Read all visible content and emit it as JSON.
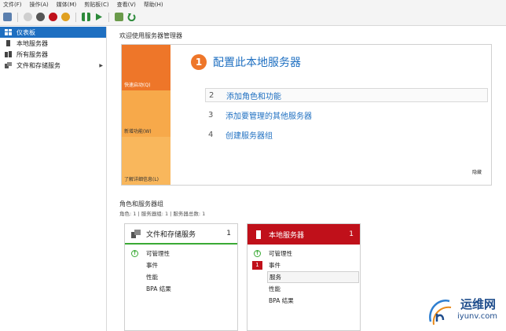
{
  "menu": [
    "文件(F)",
    "操作(A)",
    "媒体(M)",
    "剪贴板(C)",
    "查看(V)",
    "帮助(H)"
  ],
  "sidebar": {
    "items": [
      {
        "label": "仪表板"
      },
      {
        "label": "本地服务器"
      },
      {
        "label": "所有服务器"
      },
      {
        "label": "文件和存储服务"
      }
    ]
  },
  "main": {
    "welcome_title": "欢迎使用服务器管理器",
    "quickstart": {
      "side_labels": [
        "快速启动(Q)",
        "新增功能(W)",
        "了解详细信息(L)"
      ],
      "step1_number": "1",
      "step1_text": "配置此本地服务器",
      "steps": [
        {
          "num": "2",
          "label": "添加角色和功能"
        },
        {
          "num": "3",
          "label": "添加要管理的其他服务器"
        },
        {
          "num": "4",
          "label": "创建服务器组"
        }
      ],
      "hide_label": "隐藏"
    },
    "roles": {
      "title": "角色和服务器组",
      "subtitle": "角色: 1 | 服务器组: 1 | 服务器总数: 1",
      "tiles": [
        {
          "title": "文件和存储服务",
          "count": "1",
          "rows": [
            "可管理性",
            "事件",
            "性能",
            "BPA 结果"
          ]
        },
        {
          "title": "本地服务器",
          "count": "1",
          "event_alert": "1",
          "rows": [
            "可管理性",
            "事件",
            "服务",
            "性能",
            "BPA 结果"
          ]
        }
      ]
    }
  },
  "watermark": {
    "name": "运维网",
    "url": "iyunv.com"
  },
  "colors": {
    "accent_blue": "#1e6fc1",
    "quickstart_orange": "#ee7629",
    "alert_red": "#c0101a",
    "ok_green": "#3aaa35"
  }
}
